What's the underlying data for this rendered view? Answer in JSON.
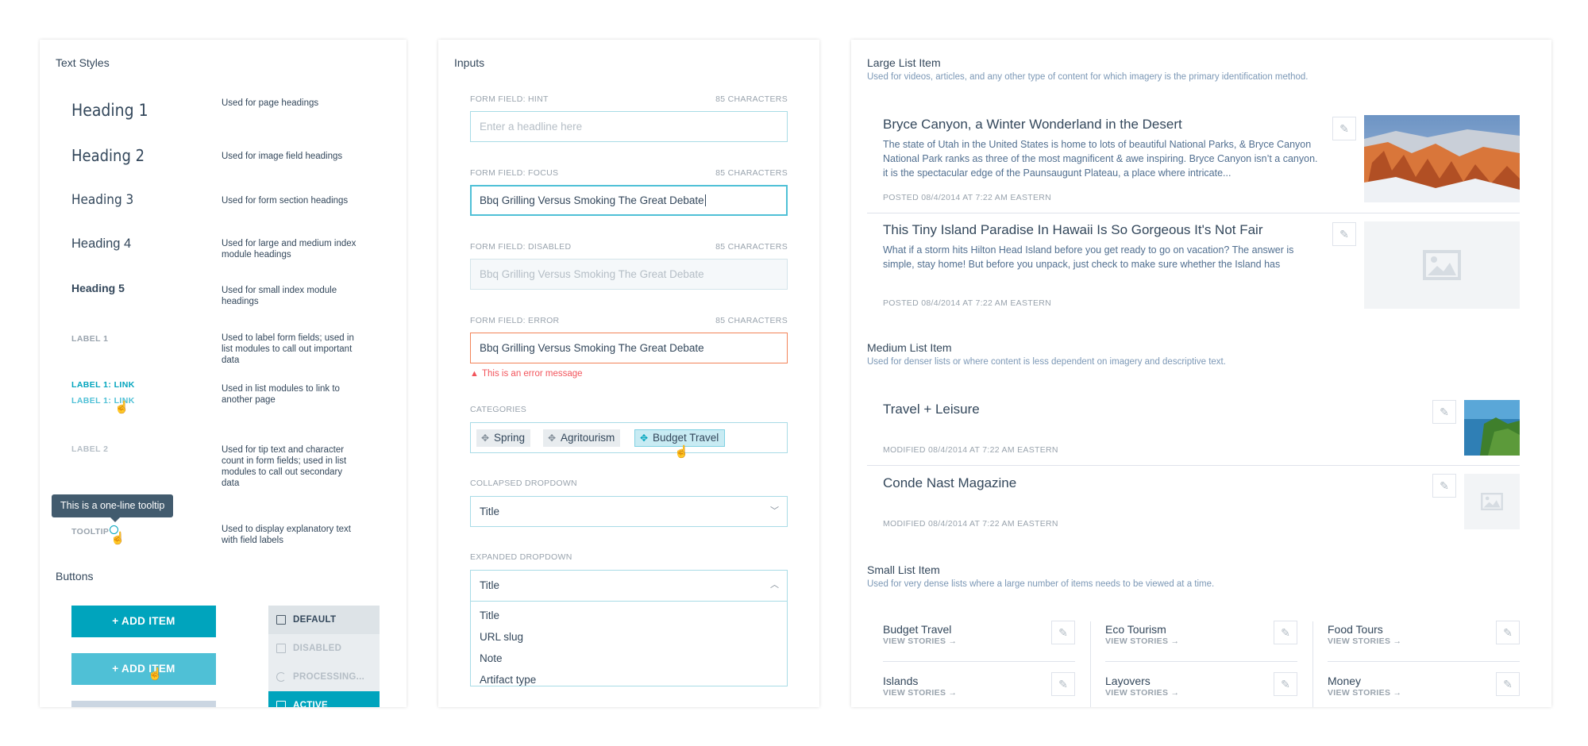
{
  "text_styles": {
    "title": "Text Styles",
    "rows": [
      {
        "sample": "Heading 1",
        "desc": "Used for page headings"
      },
      {
        "sample": "Heading 2",
        "desc": "Used for image field headings"
      },
      {
        "sample": "Heading 3",
        "desc": "Used for form section headings"
      },
      {
        "sample": "Heading 4",
        "desc": "Used for large and medium index module headings"
      },
      {
        "sample": "Heading 5",
        "desc": "Used for small index module headings"
      },
      {
        "sample": "LABEL 1",
        "desc": "Used to label form fields; used in list modules to call out important data"
      },
      {
        "sample": "LABEL 1: LINK",
        "sample2": "LABEL 1: LINK",
        "desc": "Used in list modules to link to another page"
      },
      {
        "sample": "LABEL 2",
        "desc": "Used for tip text and character count in form fields; used in list modules to call out secondary data"
      },
      {
        "sample": "TOOLTIP",
        "desc": "Used to display explanatory text with field labels"
      }
    ],
    "tooltip_text": "This is a one-line tooltip"
  },
  "buttons": {
    "title": "Buttons",
    "primary": "+ ADD ITEM",
    "primary_hover": "+ ADD ITEM",
    "states": [
      "DEFAULT",
      "DISABLED",
      "PROCESSING...",
      "ACTIVE"
    ]
  },
  "inputs": {
    "title": "Inputs",
    "hint": {
      "label": "FORM FIELD: HINT",
      "count": "85 CHARACTERS",
      "placeholder": "Enter a headline here"
    },
    "focus": {
      "label": "FORM FIELD: FOCUS",
      "count": "85 CHARACTERS",
      "value": "Bbq Grilling Versus Smoking The Great Debate"
    },
    "disabled": {
      "label": "FORM FIELD: DISABLED",
      "count": "85 CHARACTERS",
      "value": "Bbq Grilling Versus Smoking The Great Debate"
    },
    "error": {
      "label": "FORM FIELD: ERROR",
      "count": "85 CHARACTERS",
      "value": "Bbq Grilling Versus Smoking The Great Debate",
      "message": "This is an error message"
    },
    "categories": {
      "label": "CATEGORIES",
      "chips": [
        "Spring",
        "Agritourism",
        "Budget Travel"
      ]
    },
    "collapsed_dropdown": {
      "label": "COLLAPSED DROPDOWN",
      "value": "Title"
    },
    "expanded_dropdown": {
      "label": "EXPANDED DROPDOWN",
      "value": "Title",
      "options": [
        "Title",
        "URL slug",
        "Note",
        "Artifact type"
      ]
    }
  },
  "large_list": {
    "title": "Large List Item",
    "subtitle": "Used for videos, articles, and any other type of content for which imagery is the primary identification method.",
    "items": [
      {
        "title": "Bryce Canyon, a Winter Wonderland in the Desert",
        "body": "The state of Utah in the United States is home to lots of beautiful National Parks, & Bryce Canyon National Park ranks as three of the most magnificent & awe inspiring. Bryce Canyon isn’t a canyon. it is the spectacular edge of the Paunsaugunt Plateau, a place where intricate...",
        "meta": "POSTED 08/4/2014 AT 7:22 AM EASTERN"
      },
      {
        "title": "This Tiny Island Paradise In Hawaii Is So Gorgeous It's Not Fair",
        "body": "What if a storm hits Hilton Head Island before you get ready to go on vacation? The answer is simple, stay home! But before you unpack, just check to make sure whether the Island has",
        "meta": "POSTED 08/4/2014 AT 7:22 AM EASTERN"
      }
    ]
  },
  "medium_list": {
    "title": "Medium List Item",
    "subtitle": "Used for denser lists or where content is less dependent on imagery and descriptive text.",
    "items": [
      {
        "title": "Travel + Leisure",
        "meta": "MODIFIED 08/4/2014 AT 7:22 AM EASTERN"
      },
      {
        "title": "Conde Nast Magazine",
        "meta": "MODIFIED 08/4/2014 AT 7:22 AM EASTERN"
      }
    ]
  },
  "small_list": {
    "title": "Small List Item",
    "subtitle": "Used for very dense lists where a large number of items needs to be viewed at a time.",
    "link": "VIEW STORIES →",
    "items": [
      "Budget Travel",
      "Eco Tourism",
      "Food Tours",
      "Islands",
      "Layovers",
      "Money"
    ]
  },
  "colors": {
    "accent": "#00a4bd",
    "error": "#f2545b",
    "text": "#33475b",
    "muted": "#99a3ad"
  }
}
